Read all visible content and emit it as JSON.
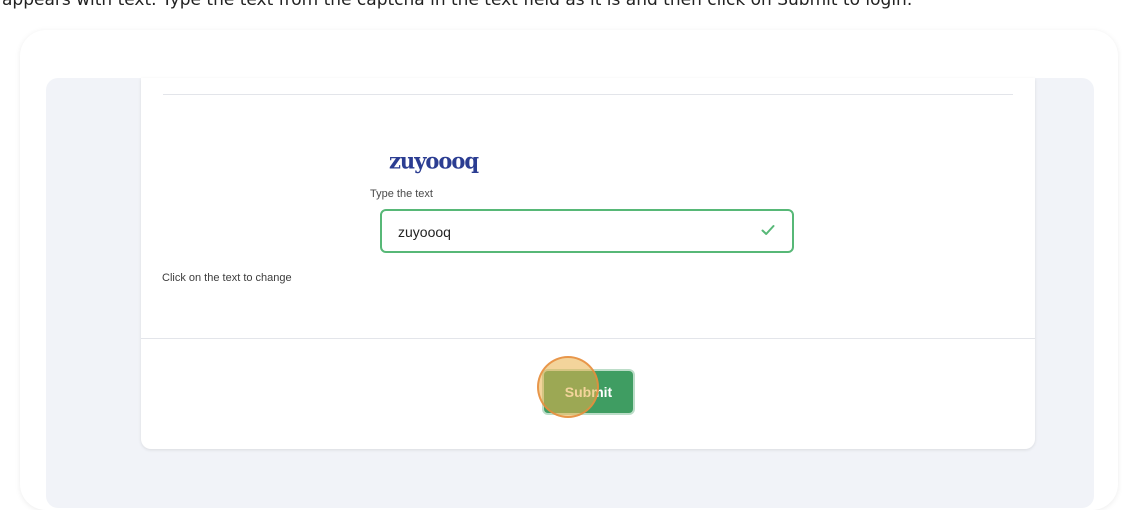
{
  "top_caption": "appears with text. Type the text from the captcha in the text field as it is and then click on Submit to login.",
  "captcha": {
    "image_text": "zuyoooq",
    "label": "Type the text",
    "input_value": "zuyoooq",
    "change_hint": "Click on the text to change"
  },
  "actions": {
    "submit_label": "Submit"
  },
  "colors": {
    "accent_green": "#3f9d62",
    "valid_border": "#57b877",
    "captcha_blue": "#2b3d92",
    "panel_bg": "#f1f3f8",
    "click_marker": "#e9b048"
  },
  "icons": {
    "valid": "check-icon"
  }
}
